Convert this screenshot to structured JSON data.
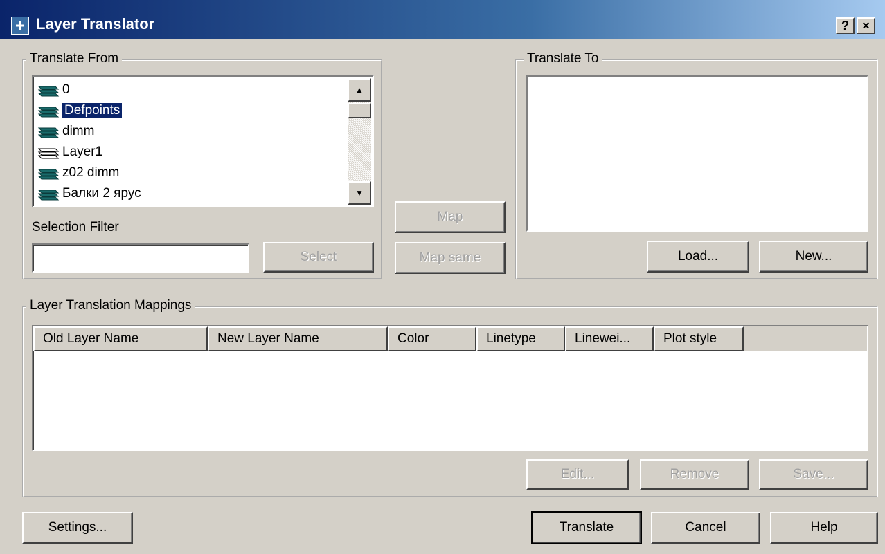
{
  "window": {
    "title": "Layer Translator",
    "help_button": "?",
    "close_button": "×"
  },
  "translate_from": {
    "legend": "Translate From",
    "layers": [
      {
        "name": "0",
        "icon": "layer-stack-icon",
        "selected": false
      },
      {
        "name": "Defpoints",
        "icon": "layer-stack-icon",
        "selected": true
      },
      {
        "name": "dimm",
        "icon": "layer-stack-icon",
        "selected": false
      },
      {
        "name": "Layer1",
        "icon": "layer-stack-outline-icon",
        "selected": false
      },
      {
        "name": "z02 dimm",
        "icon": "layer-stack-icon",
        "selected": false
      },
      {
        "name": "Балки 2 ярус",
        "icon": "layer-stack-icon",
        "selected": false
      }
    ],
    "selection_filter_label": "Selection Filter",
    "selection_filter_value": "",
    "select_button": "Select"
  },
  "middle": {
    "map_button": "Map",
    "map_same_button": "Map same"
  },
  "translate_to": {
    "legend": "Translate To",
    "load_button": "Load...",
    "new_button": "New..."
  },
  "mappings": {
    "legend": "Layer Translation Mappings",
    "columns": [
      "Old Layer Name",
      "New Layer Name",
      "Color",
      "Linetype",
      "Linewei...",
      "Plot style"
    ],
    "rows": [],
    "edit_button": "Edit...",
    "remove_button": "Remove",
    "save_button": "Save..."
  },
  "footer": {
    "settings_button": "Settings...",
    "translate_button": "Translate",
    "cancel_button": "Cancel",
    "help_button": "Help"
  },
  "colors": {
    "titlebar_start": "#0a246a",
    "titlebar_end": "#a6caf0",
    "dialog_face": "#d4d0c8",
    "selection": "#0a246a",
    "layer_icon": "#1a6b6b"
  }
}
